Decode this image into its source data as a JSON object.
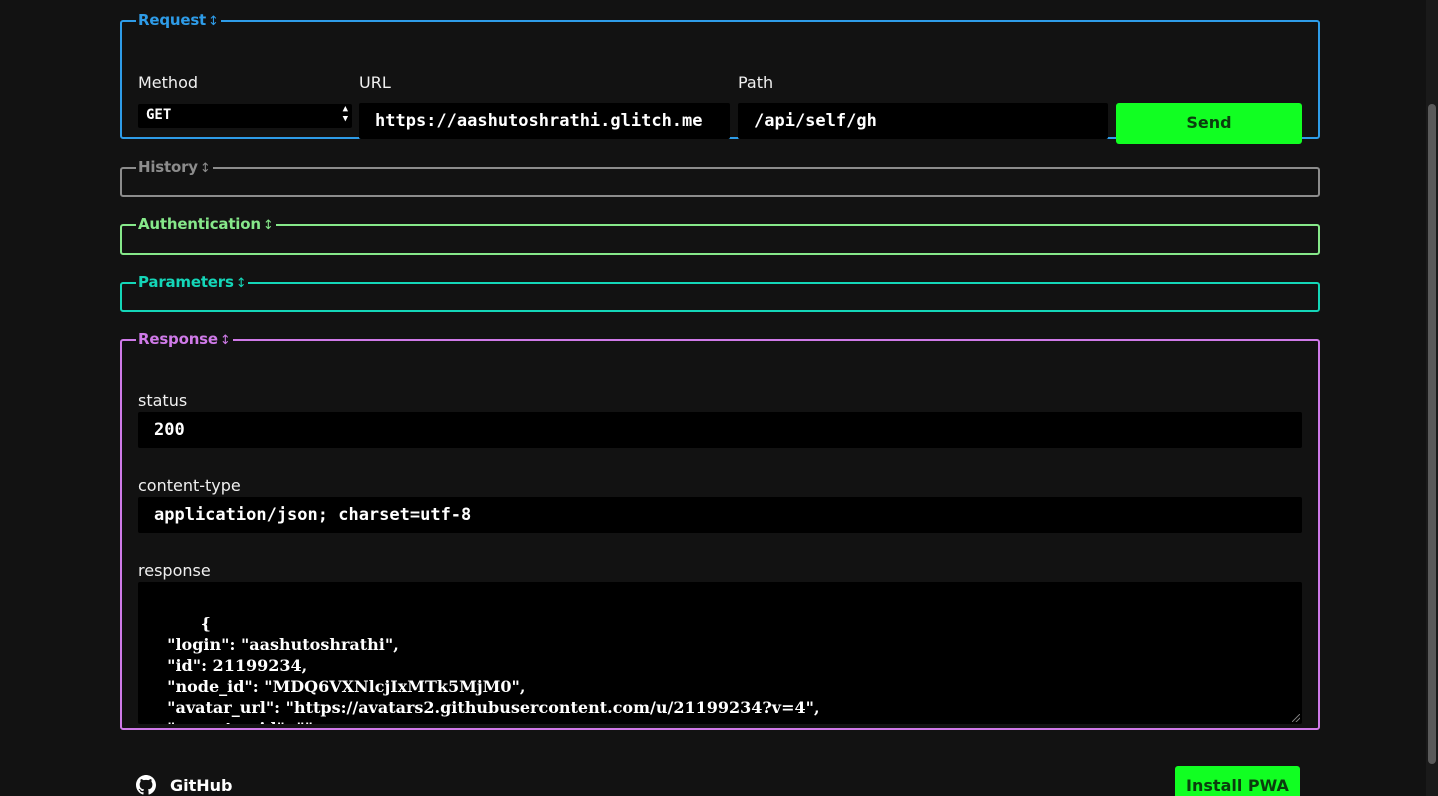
{
  "request": {
    "legend": "Request",
    "method_label": "Method",
    "method_value": "GET",
    "url_label": "URL",
    "url_value": "https://aashutoshrathi.glitch.me",
    "path_label": "Path",
    "path_value": "/api/self/gh",
    "send_label": "Send"
  },
  "history": {
    "legend": "History"
  },
  "authentication": {
    "legend": "Authentication"
  },
  "parameters": {
    "legend": "Parameters"
  },
  "response": {
    "legend": "Response",
    "status_label": "status",
    "status_value": "200",
    "content_type_label": "content-type",
    "content_type_value": "application/json; charset=utf-8",
    "response_label": "response",
    "response_body": "{\n  \"login\": \"aashutoshrathi\",\n  \"id\": 21199234,\n  \"node_id\": \"MDQ6VXNlcjIxMTk5MjM0\",\n  \"avatar_url\": \"https://avatars2.githubusercontent.com/u/21199234?v=4\",\n  \"gravatar_id\": \"\",\n  \"url\": \"https://api.github.com/users/aashutoshrathi\","
  },
  "footer": {
    "github_label": "GitHub",
    "install_label": "Install PWA"
  },
  "colors": {
    "request": "#2e9ce8",
    "history": "#8c8c8c",
    "authentication": "#86e88a",
    "parameters": "#14d6b8",
    "response": "#cf7ae8",
    "accent_button": "#11ff22"
  },
  "icons": {
    "legend_toggle": "up-down-arrow-icon",
    "footer_github": "github-icon"
  }
}
